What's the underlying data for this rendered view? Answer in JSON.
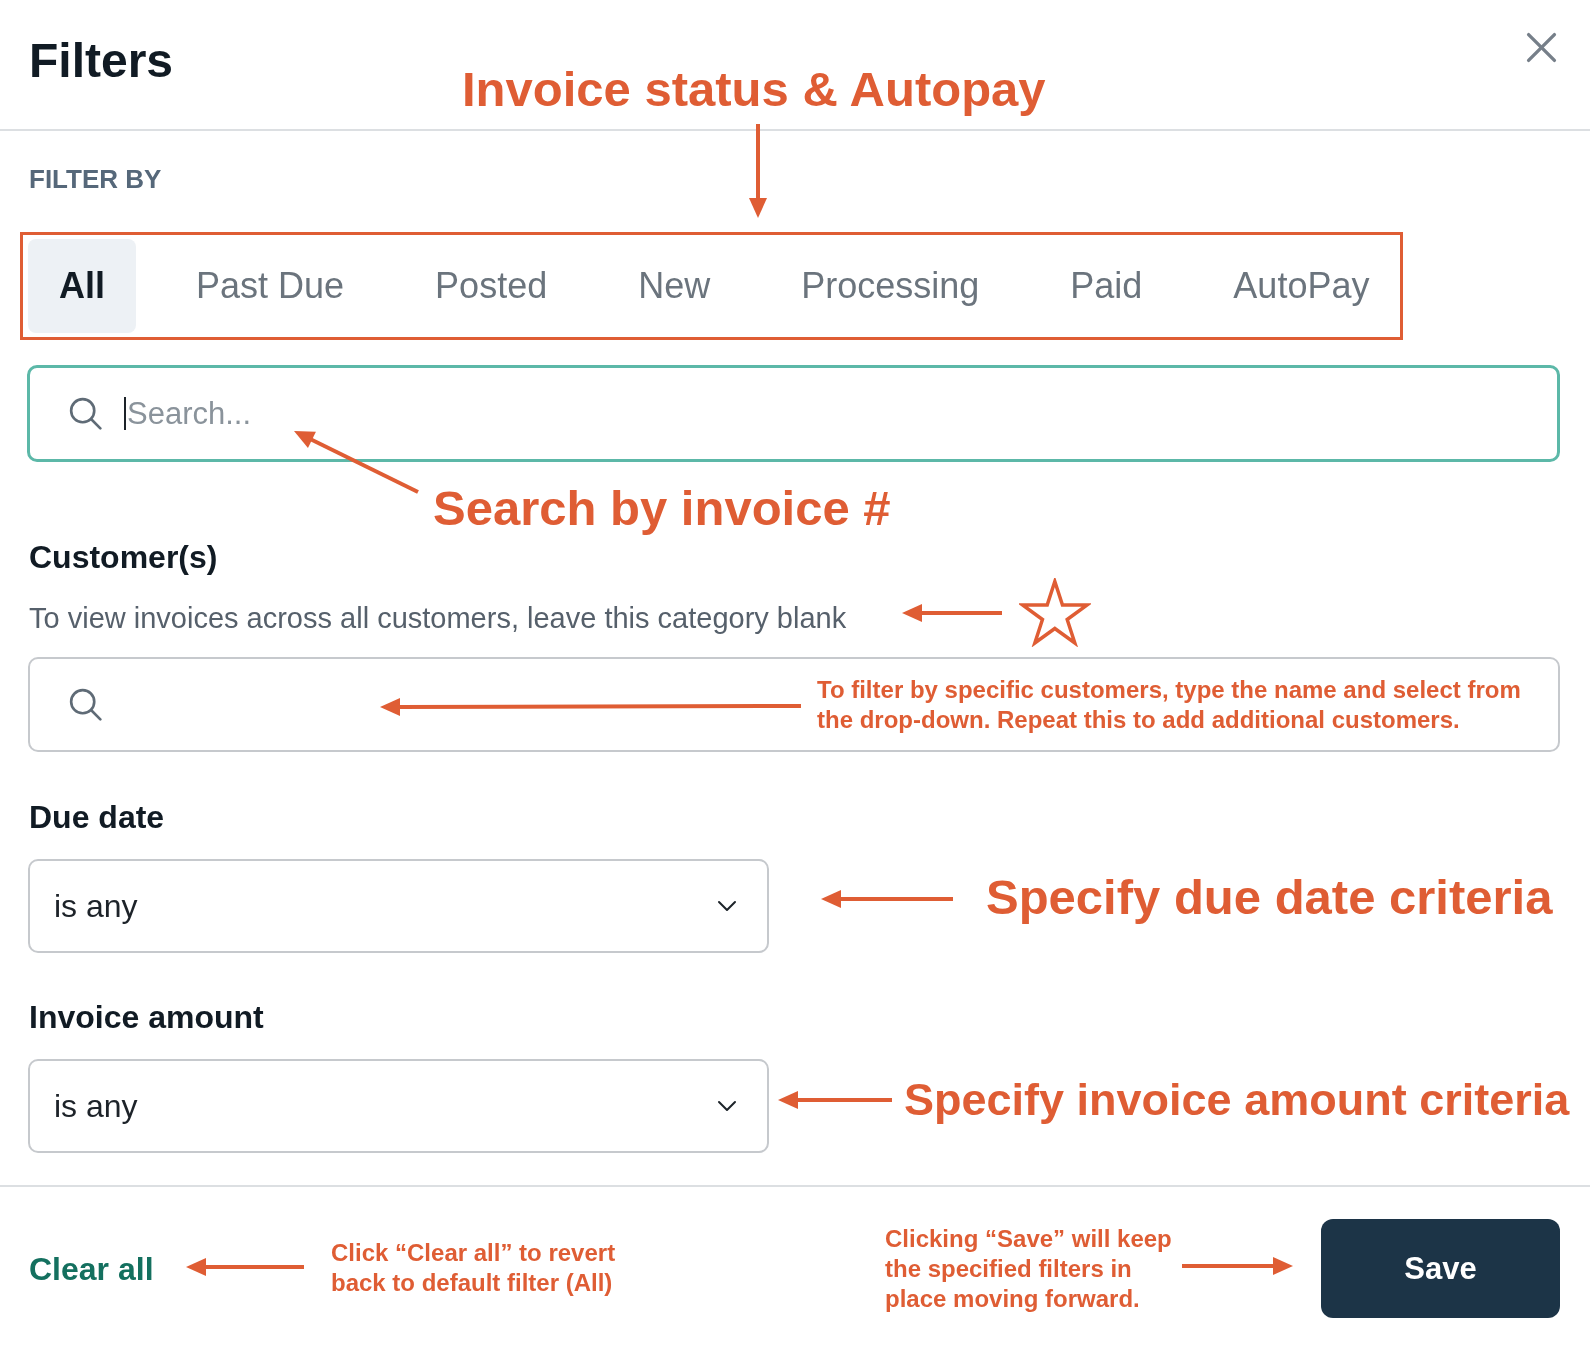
{
  "header": {
    "title": "Filters",
    "annotation": "Invoice status & Autopay"
  },
  "filter_by": {
    "label": "FILTER BY",
    "tabs": [
      {
        "label": "All",
        "selected": true
      },
      {
        "label": "Past Due",
        "selected": false
      },
      {
        "label": "Posted",
        "selected": false
      },
      {
        "label": "New",
        "selected": false
      },
      {
        "label": "Processing",
        "selected": false
      },
      {
        "label": "Paid",
        "selected": false
      },
      {
        "label": "AutoPay",
        "selected": false
      }
    ]
  },
  "search": {
    "placeholder": "Search...",
    "focused": true,
    "annotation": "Search by invoice #"
  },
  "customers": {
    "label": "Customer(s)",
    "description": "To view invoices across all customers, leave this category blank",
    "note": "To filter by specific customers, type the name and select from\nthe drop-down. Repeat this to add additional customers."
  },
  "due_date": {
    "label": "Due date",
    "value": "is any",
    "annotation": "Specify due date criteria"
  },
  "invoice_amount": {
    "label": "Invoice amount",
    "value": "is any",
    "annotation": "Specify invoice amount criteria"
  },
  "footer": {
    "clear_button": "Clear all",
    "clear_note": "Click “Clear all” to revert\nback to default filter (All)",
    "save_note": "Clicking “Save” will keep\nthe specified filters in\nplace moving forward.",
    "save_button": "Save"
  }
}
